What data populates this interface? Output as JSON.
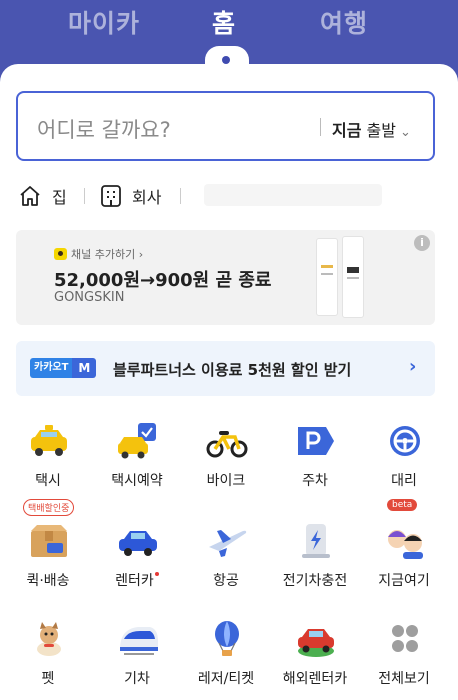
{
  "top_tabs": [
    {
      "label": "마이카"
    },
    {
      "label": "홈"
    },
    {
      "label": "여행"
    }
  ],
  "search": {
    "placeholder": "어디로 갈까요?",
    "depart_bold": "지금",
    "depart_text": "출발"
  },
  "places": {
    "home": "집",
    "work": "회사"
  },
  "ad": {
    "channel": "채널 추가하기",
    "title": "52,000원→900원 곧 종료",
    "brand": "GONGSKIN",
    "info": "i"
  },
  "promo": {
    "badge_kakao": "카카오T",
    "badge_m": "M",
    "text": "블루파트너스 이용료 5천원 할인 받기"
  },
  "services": [
    {
      "label": "택시",
      "icon": "taxi-icon"
    },
    {
      "label": "택시예약",
      "icon": "taxi-reservation-icon"
    },
    {
      "label": "바이크",
      "icon": "bike-icon"
    },
    {
      "label": "주차",
      "icon": "parking-icon"
    },
    {
      "label": "대리",
      "icon": "steering-wheel-icon"
    },
    {
      "label": "퀵·배송",
      "icon": "delivery-box-icon",
      "tag": "택배할인중"
    },
    {
      "label": "렌터카",
      "icon": "rental-car-icon"
    },
    {
      "label": "항공",
      "icon": "airplane-icon"
    },
    {
      "label": "전기차충전",
      "icon": "ev-charger-icon"
    },
    {
      "label": "지금여기",
      "icon": "people-icon",
      "tag": "beta"
    },
    {
      "label": "펫",
      "icon": "pet-dog-icon"
    },
    {
      "label": "기차",
      "icon": "train-icon"
    },
    {
      "label": "레저/티켓",
      "icon": "hot-air-balloon-icon"
    },
    {
      "label": "해외렌터카",
      "icon": "overseas-rental-car-icon"
    },
    {
      "label": "전체보기",
      "icon": "grid-dots-icon"
    }
  ],
  "colors": {
    "header": "#4a55b0",
    "accent": "#4a63d6",
    "taxi_yellow": "#f4c20d",
    "badge_red": "#e24a3b"
  }
}
